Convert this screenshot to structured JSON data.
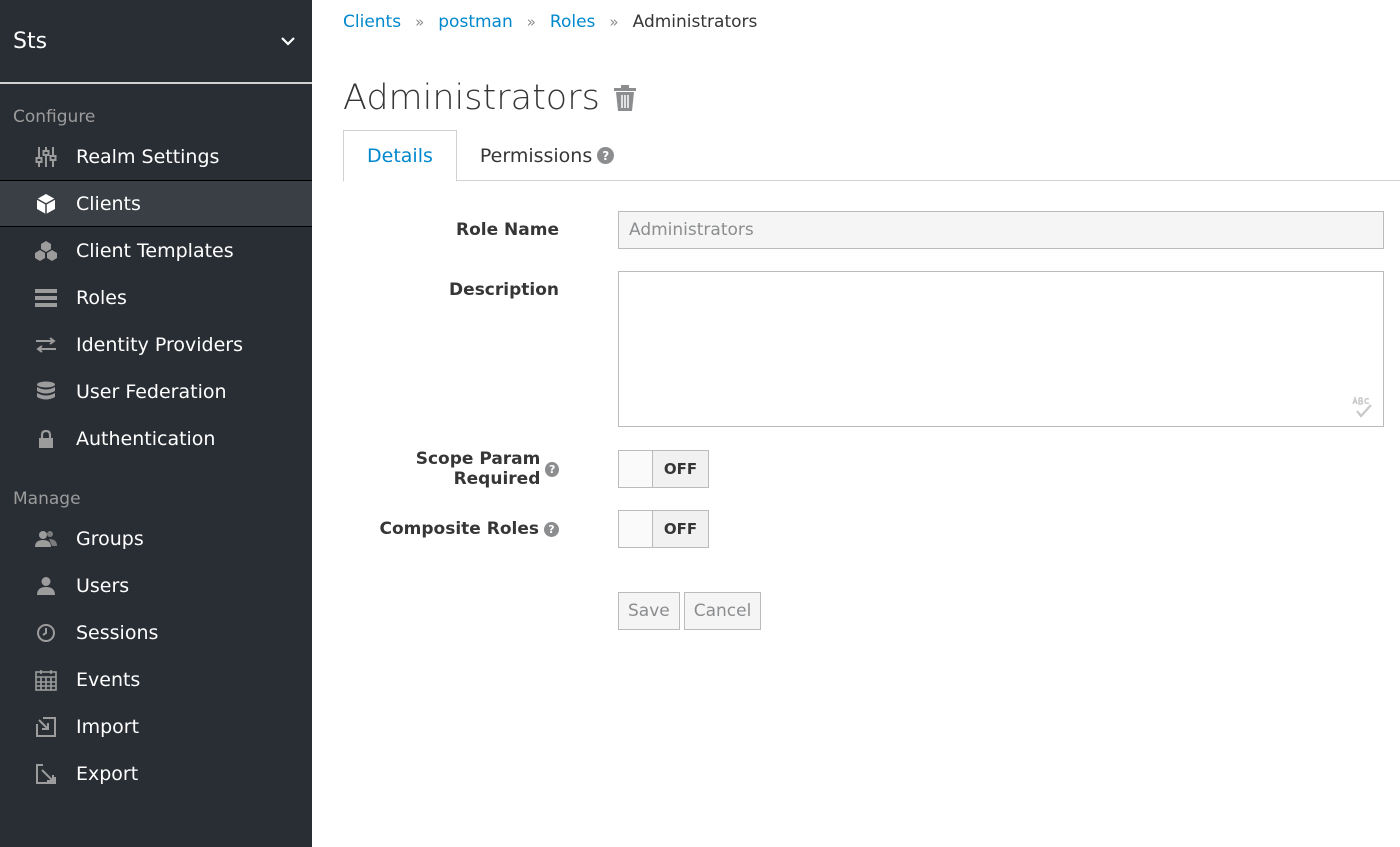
{
  "sidebar": {
    "realm_name": "Sts",
    "configure_label": "Configure",
    "manage_label": "Manage",
    "configure_items": [
      {
        "label": "Realm Settings",
        "icon": "sliders-icon"
      },
      {
        "label": "Clients",
        "icon": "cube-icon",
        "active": true
      },
      {
        "label": "Client Templates",
        "icon": "cubes-icon"
      },
      {
        "label": "Roles",
        "icon": "list-icon"
      },
      {
        "label": "Identity Providers",
        "icon": "exchange-icon"
      },
      {
        "label": "User Federation",
        "icon": "database-icon"
      },
      {
        "label": "Authentication",
        "icon": "lock-icon"
      }
    ],
    "manage_items": [
      {
        "label": "Groups",
        "icon": "group-icon"
      },
      {
        "label": "Users",
        "icon": "user-icon"
      },
      {
        "label": "Sessions",
        "icon": "clock-icon"
      },
      {
        "label": "Events",
        "icon": "calendar-icon"
      },
      {
        "label": "Import",
        "icon": "import-icon"
      },
      {
        "label": "Export",
        "icon": "export-icon"
      }
    ]
  },
  "breadcrumb": {
    "items": [
      "Clients",
      "postman",
      "Roles"
    ],
    "current": "Administrators"
  },
  "page": {
    "title": "Administrators"
  },
  "tabs": {
    "details": "Details",
    "permissions": "Permissions"
  },
  "form": {
    "role_name_label": "Role Name",
    "role_name_value": "Administrators",
    "description_label": "Description",
    "description_value": "",
    "scope_param_label": "Scope Param Required",
    "scope_param_state": "OFF",
    "composite_roles_label": "Composite Roles",
    "composite_roles_state": "OFF",
    "save_label": "Save",
    "cancel_label": "Cancel"
  },
  "colors": {
    "sidebar_bg": "#292e34",
    "active_item_bg": "#393f44",
    "link": "#0088ce",
    "text": "#363636"
  }
}
